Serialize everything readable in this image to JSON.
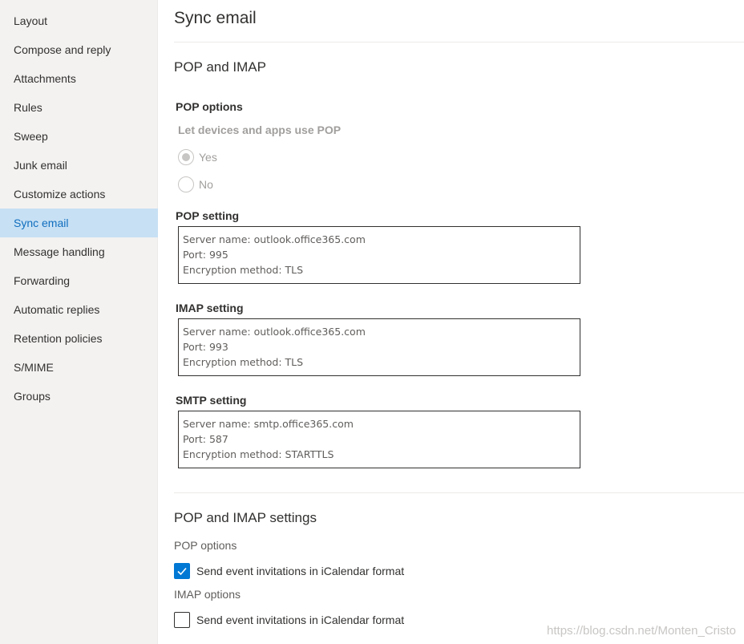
{
  "sidebar": {
    "items": [
      {
        "label": "Layout"
      },
      {
        "label": "Compose and reply"
      },
      {
        "label": "Attachments"
      },
      {
        "label": "Rules"
      },
      {
        "label": "Sweep"
      },
      {
        "label": "Junk email"
      },
      {
        "label": "Customize actions"
      },
      {
        "label": "Sync email",
        "active": true
      },
      {
        "label": "Message handling"
      },
      {
        "label": "Forwarding"
      },
      {
        "label": "Automatic replies"
      },
      {
        "label": "Retention policies"
      },
      {
        "label": "S/MIME"
      },
      {
        "label": "Groups"
      }
    ]
  },
  "main": {
    "title": "Sync email",
    "pop_imap": {
      "title": "POP and IMAP",
      "pop_options_label": "POP options",
      "let_devices_label": "Let devices and apps use POP",
      "radio_yes": "Yes",
      "radio_no": "No",
      "selected": "Yes",
      "pop_setting": {
        "label": "POP setting",
        "server": "Server name: outlook.office365.com",
        "port": "Port: 995",
        "encryption": "Encryption method: TLS"
      },
      "imap_setting": {
        "label": "IMAP setting",
        "server": "Server name: outlook.office365.com",
        "port": "Port: 993",
        "encryption": "Encryption method: TLS"
      },
      "smtp_setting": {
        "label": "SMTP setting",
        "server": "Server name: smtp.office365.com",
        "port": "Port: 587",
        "encryption": "Encryption method: STARTTLS"
      }
    },
    "pop_imap_settings": {
      "title": "POP and IMAP settings",
      "pop_options_label": "POP options",
      "pop_checkbox_label": "Send event invitations in iCalendar format",
      "pop_checked": true,
      "imap_options_label": "IMAP options",
      "imap_checkbox_label": "Send event invitations in iCalendar format",
      "imap_checked": false
    }
  },
  "watermark": "https://blog.csdn.net/Monten_Cristo",
  "colors": {
    "accent": "#0078d4",
    "active_nav_bg": "#c7e0f4",
    "active_nav_text": "#106ebe",
    "sidebar_bg": "#f3f2f1"
  }
}
